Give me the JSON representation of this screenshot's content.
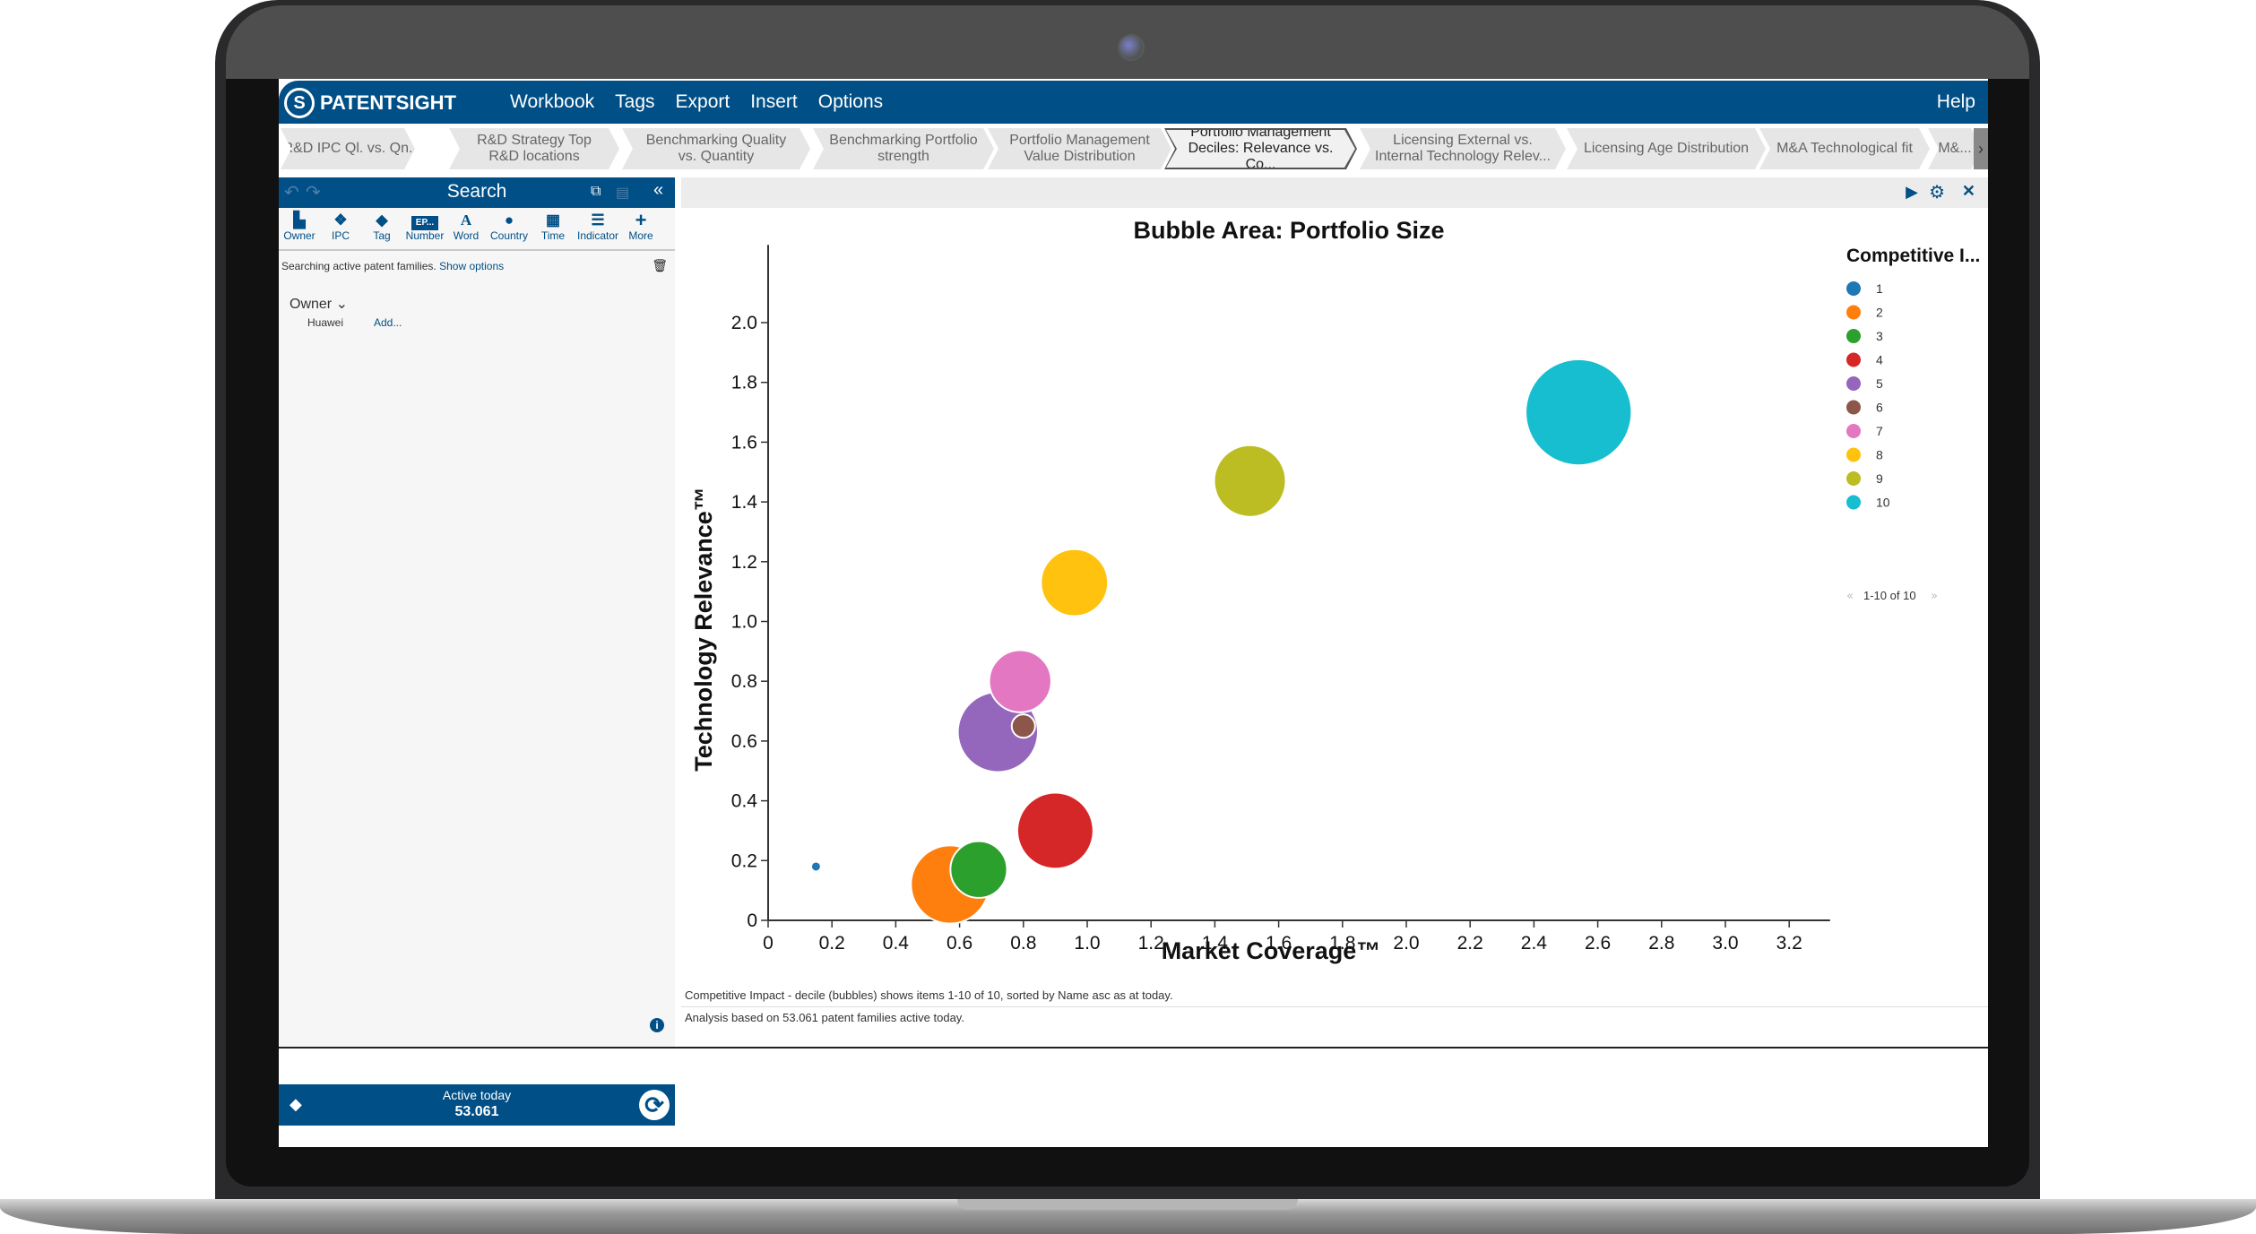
{
  "app": {
    "brand": "PATENTSIGHT",
    "brand_mark": "S"
  },
  "menu": {
    "items": [
      "Workbook",
      "Tags",
      "Export",
      "Insert",
      "Options"
    ],
    "help": "Help"
  },
  "tabs": [
    {
      "label": "R&D IPC Ql. vs. Qn.",
      "active": false
    },
    {
      "label": "R&D Strategy Top R&D locations",
      "active": false
    },
    {
      "label": "Benchmarking Quality vs. Quantity",
      "active": false
    },
    {
      "label": "Benchmarking Portfolio strength",
      "active": false
    },
    {
      "label": "Portfolio Management Value Distribution",
      "active": false
    },
    {
      "label": "Portfolio Management Deciles: Relevance vs. Co...",
      "active": true
    },
    {
      "label": "Licensing External vs. Internal  Technology Relev...",
      "active": false
    },
    {
      "label": "Licensing Age Distribution",
      "active": false
    },
    {
      "label": "M&A Technological fit",
      "active": false
    },
    {
      "label": "M&...",
      "active": false
    }
  ],
  "tab_scroll": "›",
  "sidebar": {
    "title": "Search",
    "filters": [
      {
        "label": "Owner",
        "icon": "factory-icon",
        "glyph": "▙"
      },
      {
        "label": "IPC",
        "icon": "cubes-icon",
        "glyph": "❖"
      },
      {
        "label": "Tag",
        "icon": "tag-icon",
        "glyph": "◆"
      },
      {
        "label": "Number",
        "icon": "ep-number-icon",
        "glyph": "EP..."
      },
      {
        "label": "Word",
        "icon": "letter-a-icon",
        "glyph": "A"
      },
      {
        "label": "Country",
        "icon": "globe-icon",
        "glyph": "●"
      },
      {
        "label": "Time",
        "icon": "calendar-icon",
        "glyph": "▦"
      },
      {
        "label": "Indicator",
        "icon": "sliders-icon",
        "glyph": "☰"
      },
      {
        "label": "More",
        "icon": "plus-icon",
        "glyph": "+"
      }
    ],
    "status_text": "Searching active patent families.",
    "status_link": "Show options",
    "owner_label": "Owner ⌄",
    "owner_value": "Huawei",
    "owner_add": "Add...",
    "footer_label": "Active today",
    "footer_count": "53.061"
  },
  "chart_footer": {
    "line1": "Competitive Impact - decile (bubbles) shows items 1-10 of 10, sorted by Name asc as at today.",
    "line2": "Analysis based on 53.061 patent families active today."
  },
  "chart_data": {
    "type": "scatter",
    "subtype": "bubble",
    "title": "Bubble Area: Portfolio Size",
    "xlabel": "Market Coverage™",
    "ylabel": "Technology Relevance™",
    "xlim": [
      0,
      3.3
    ],
    "ylim": [
      0,
      2.2
    ],
    "xticks": [
      "0",
      "0.2",
      "0.4",
      "0.6",
      "0.8",
      "1.0",
      "1.2",
      "1.4",
      "1.6",
      "1.8",
      "2.0",
      "2.2",
      "2.4",
      "2.6",
      "2.8",
      "3.0",
      "3.2"
    ],
    "yticks": [
      "0",
      "0.2",
      "0.4",
      "0.6",
      "0.8",
      "1.0",
      "1.2",
      "1.4",
      "1.6",
      "1.8",
      "2.0"
    ],
    "legend_title": "Competitive I...",
    "legend_position": "right",
    "legend_pager": "1-10 of 10",
    "series": [
      {
        "name": "1",
        "color": "#1f77b4",
        "x": 0.15,
        "y": 0.18,
        "size": 0.3
      },
      {
        "name": "2",
        "color": "#ff7f0e",
        "x": 0.57,
        "y": 0.12,
        "size": 19
      },
      {
        "name": "3",
        "color": "#2ca02c",
        "x": 0.66,
        "y": 0.17,
        "size": 10
      },
      {
        "name": "4",
        "color": "#d62728",
        "x": 0.9,
        "y": 0.3,
        "size": 18
      },
      {
        "name": "5",
        "color": "#9467bd",
        "x": 0.72,
        "y": 0.63,
        "size": 20
      },
      {
        "name": "6",
        "color": "#8c564b",
        "x": 0.8,
        "y": 0.65,
        "size": 1.7
      },
      {
        "name": "7",
        "color": "#e377c2",
        "x": 0.79,
        "y": 0.8,
        "size": 12
      },
      {
        "name": "8",
        "color": "#ffc20e",
        "x": 0.96,
        "y": 1.13,
        "size": 14
      },
      {
        "name": "9",
        "color": "#bcbd22",
        "x": 1.51,
        "y": 1.47,
        "size": 16
      },
      {
        "name": "10",
        "color": "#17becf",
        "x": 2.54,
        "y": 1.7,
        "size": 35
      }
    ]
  }
}
